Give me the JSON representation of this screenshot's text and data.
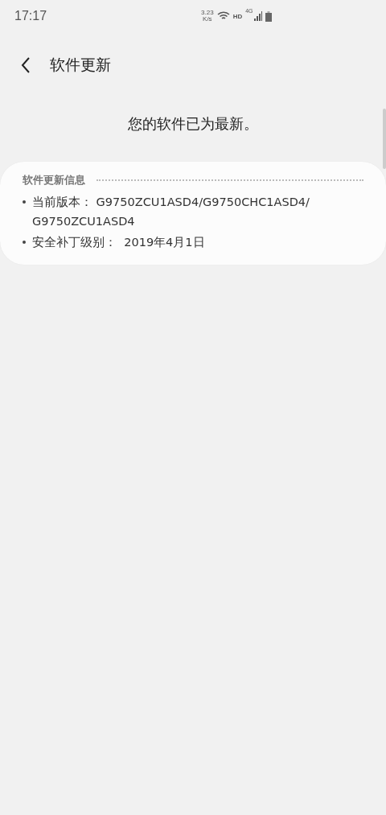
{
  "status_bar": {
    "time": "17:17",
    "net_speed": "3.23",
    "net_speed_unit": "K/s",
    "hd": "HD",
    "network": "4G"
  },
  "header": {
    "title": "软件更新"
  },
  "message": "您的软件已为最新。",
  "info_card": {
    "heading": "软件更新信息",
    "items": [
      "当前版本： G9750ZCU1ASD4/G9750CHC1ASD4/ G9750ZCU1ASD4",
      "安全补丁级别：  2019年4月1日"
    ]
  }
}
